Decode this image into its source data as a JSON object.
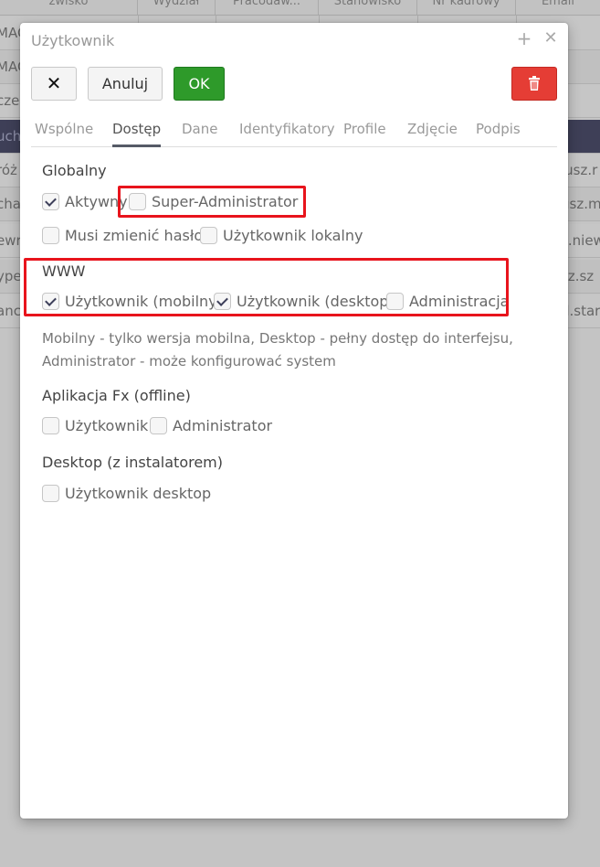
{
  "background_table": {
    "headers": [
      "zwisko",
      "Wydział",
      "Pracodaw...",
      "Stanowisko",
      "Nr kadrowy",
      "Email"
    ],
    "rows": [
      {
        "left": "MAG",
        "right": ""
      },
      {
        "left": "MAG",
        "right": ""
      },
      {
        "left": "czek",
        "right": ""
      },
      {
        "left": "uch",
        "right": "",
        "selected": true
      },
      {
        "left": "róż",
        "right": "iusz.r"
      },
      {
        "left": "cha",
        "right": "usz.m"
      },
      {
        "left": "ewr",
        "right": "z.niew"
      },
      {
        "left": "ype",
        "right": "sz.sz"
      },
      {
        "left": "anc",
        "right": "d.star"
      }
    ]
  },
  "dialog": {
    "title": "Użytkownik",
    "icons": {
      "maximize": "plus-icon",
      "close": "close-icon"
    },
    "toolbar": {
      "close_label": "✕",
      "cancel_label": "Anuluj",
      "ok_label": "OK",
      "delete_icon": "trash-icon"
    },
    "tabs": [
      {
        "label": "Wspólne",
        "active": false
      },
      {
        "label": "Dostęp",
        "active": true
      },
      {
        "label": "Dane",
        "active": false
      },
      {
        "label": "Identyfikatory",
        "active": false
      },
      {
        "label": "Profile",
        "active": false
      },
      {
        "label": "Zdjęcie",
        "active": false
      },
      {
        "label": "Podpis",
        "active": false
      }
    ],
    "sections": {
      "global": {
        "title": "Globalny",
        "options": [
          {
            "label": "Aktywny",
            "checked": true
          },
          {
            "label": "Super-Administrator",
            "checked": false,
            "highlighted": true
          },
          {
            "label": "Musi zmienić hasło",
            "checked": false
          },
          {
            "label": "Użytkownik lokalny",
            "checked": false
          }
        ]
      },
      "www": {
        "title": "WWW",
        "highlighted": true,
        "options": [
          {
            "label": "Użytkownik (mobilny)",
            "checked": true
          },
          {
            "label": "Użytkownik (desktop)",
            "checked": true
          },
          {
            "label": "Administracja",
            "checked": false
          }
        ],
        "description": "Mobilny - tylko wersja mobilna, Desktop - pełny dostęp do interfejsu, Administrator - może konfigurować system"
      },
      "fx": {
        "title": "Aplikacja Fx (offline)",
        "options": [
          {
            "label": "Użytkownik",
            "checked": false
          },
          {
            "label": "Administrator",
            "checked": false
          }
        ]
      },
      "desktop": {
        "title": "Desktop (z instalatorem)",
        "options": [
          {
            "label": "Użytkownik desktop",
            "checked": false
          }
        ]
      }
    },
    "colors": {
      "ok": "#2e9a2a",
      "delete": "#e53d35",
      "highlight": "#e8141c",
      "selected_row": "#3e3f57"
    }
  }
}
